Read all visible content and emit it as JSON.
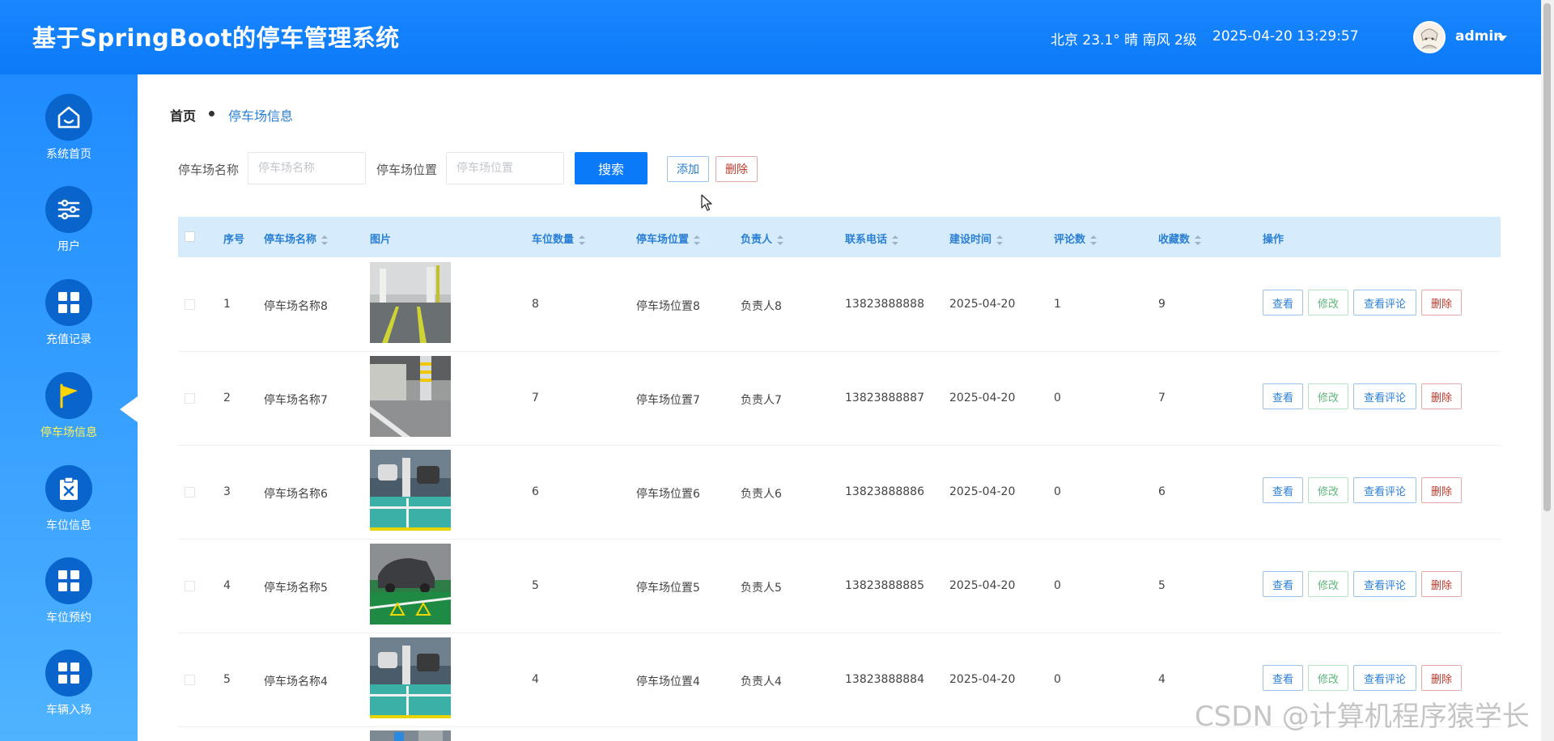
{
  "header": {
    "title": "基于SpringBoot的停车管理系统",
    "weather": "北京 23.1° 晴 南风 2级",
    "datetime": "2025-04-20 13:29:57",
    "username": "admin"
  },
  "sidebar": {
    "items": [
      {
        "label": "系统首页",
        "icon": "home-icon"
      },
      {
        "label": "用户",
        "icon": "sliders-icon"
      },
      {
        "label": "充值记录",
        "icon": "grid-icon"
      },
      {
        "label": "停车场信息",
        "icon": "flag-icon",
        "active": true
      },
      {
        "label": "车位信息",
        "icon": "clipboard-x-icon"
      },
      {
        "label": "车位预约",
        "icon": "grid-icon"
      },
      {
        "label": "车辆入场",
        "icon": "grid-icon"
      }
    ]
  },
  "breadcrumb": {
    "home": "首页",
    "current": "停车场信息"
  },
  "search": {
    "name_label": "停车场名称",
    "name_placeholder": "停车场名称",
    "location_label": "停车场位置",
    "location_placeholder": "停车场位置",
    "search_button": "搜索",
    "add_button": "添加",
    "delete_button": "删除"
  },
  "table": {
    "columns": [
      "序号",
      "停车场名称",
      "图片",
      "车位数量",
      "停车场位置",
      "负责人",
      "联系电话",
      "建设时间",
      "评论数",
      "收藏数",
      "操作"
    ],
    "rows": [
      {
        "index": "1",
        "name": "停车场名称8",
        "spots": "8",
        "location": "停车场位置8",
        "manager": "负责人8",
        "phone": "13823888888",
        "built": "2025-04-20",
        "comments": "1",
        "favorites": "9"
      },
      {
        "index": "2",
        "name": "停车场名称7",
        "spots": "7",
        "location": "停车场位置7",
        "manager": "负责人7",
        "phone": "13823888887",
        "built": "2025-04-20",
        "comments": "0",
        "favorites": "7"
      },
      {
        "index": "3",
        "name": "停车场名称6",
        "spots": "6",
        "location": "停车场位置6",
        "manager": "负责人6",
        "phone": "13823888886",
        "built": "2025-04-20",
        "comments": "0",
        "favorites": "6"
      },
      {
        "index": "4",
        "name": "停车场名称5",
        "spots": "5",
        "location": "停车场位置5",
        "manager": "负责人5",
        "phone": "13823888885",
        "built": "2025-04-20",
        "comments": "0",
        "favorites": "5"
      },
      {
        "index": "5",
        "name": "停车场名称4",
        "spots": "4",
        "location": "停车场位置4",
        "manager": "负责人4",
        "phone": "13823888884",
        "built": "2025-04-20",
        "comments": "0",
        "favorites": "4"
      }
    ],
    "actions": {
      "view": "查看",
      "edit": "修改",
      "view_comments": "查看评论",
      "delete": "删除"
    }
  },
  "watermark": "CSDN @计算机程序猿学长",
  "colors": {
    "primary": "#0b7af8",
    "sidebar_active_text": "#fff352",
    "nav_circle": "#0964cc",
    "danger": "#c0392b",
    "success": "#5cb87a"
  }
}
